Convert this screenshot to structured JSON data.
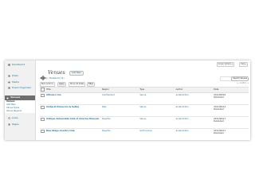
{
  "window": {
    "header_buttons": [
      "Screen Options ▾",
      "Help ▾"
    ]
  },
  "sidebar": {
    "items": [
      {
        "label": "Dashboard",
        "icon": "dashboard-icon"
      },
      {
        "label": "Posts",
        "icon": "pushpin-icon"
      },
      {
        "label": "Media",
        "icon": "media-icon"
      },
      {
        "label": "Event Organizer",
        "icon": "calendar-icon"
      },
      {
        "label": "Venues",
        "icon": "venue-icon",
        "active": true
      },
      {
        "label": "Links",
        "icon": "link-icon"
      },
      {
        "label": "Pages",
        "icon": "page-icon"
      }
    ],
    "submenu": [
      "Venues",
      "Add New",
      "Venue Types",
      "Venue Regions"
    ]
  },
  "main": {
    "title": "Venues",
    "add_new": "Add New",
    "filters": {
      "all": "All (11)",
      "published": "Published (11)"
    },
    "search_button": "Search Venues",
    "bulk_actions": "Bulk Actions",
    "apply": "Apply",
    "show_all_dates": "Show all dates",
    "filter": "Filter",
    "pager": "« ‹ 1 of 2 › »"
  },
  "table": {
    "headers": [
      "Title",
      "Region",
      "Type",
      "Author",
      "Date"
    ],
    "rows": [
      {
        "title": "Alfredo's Inn",
        "region": "Cumberland",
        "type": "Venue",
        "author": "andandchris",
        "date": "2011/06/16",
        "status": "Published"
      },
      {
        "title": "Amherst House Inn & Suites",
        "region": "Peel",
        "type": "Venue",
        "author": "andandchris",
        "date": "2011/06/14",
        "status": "Published"
      },
      {
        "title": "Antique Automobile Club of America Museum",
        "region": "Dauphin",
        "type": "Venue",
        "author": "andandchris",
        "date": "2011/06/17",
        "status": "Published"
      },
      {
        "title": "Blue Ridge Country Club",
        "region": "Dauphin",
        "type": "Golf Course",
        "author": "andandchris",
        "date": "2011/06/17",
        "status": "Published"
      }
    ]
  },
  "colors": {
    "link": "#21759b",
    "sidebar_bg": "#f1f1f1",
    "active_bg": "#6d6d6d"
  }
}
